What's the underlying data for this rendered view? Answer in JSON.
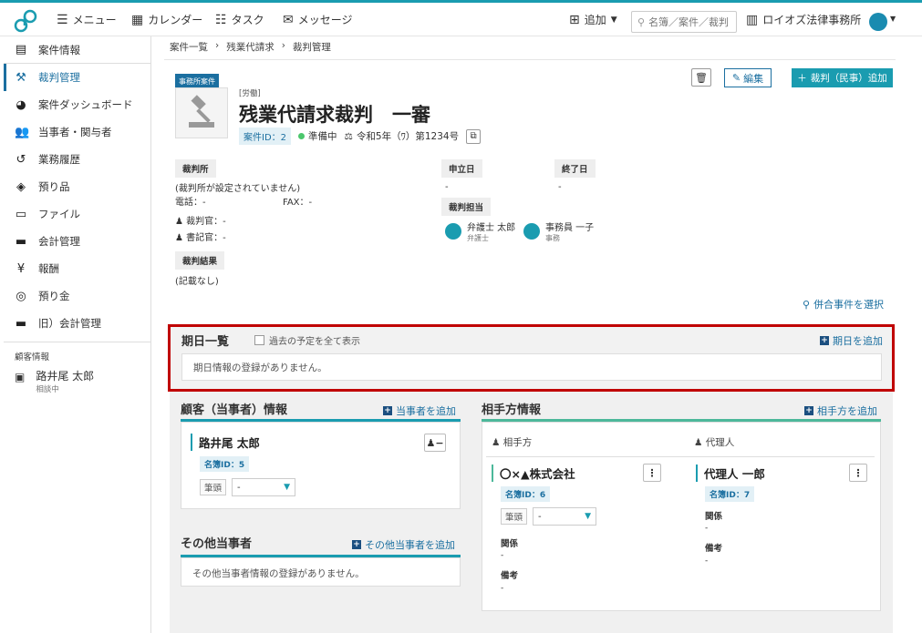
{
  "header": {
    "menu": "メニュー",
    "calendar": "カレンダー",
    "task": "タスク",
    "message": "メッセージ",
    "add": "追加",
    "search_placeholder": "名簿／案件／裁判",
    "office": "ロイオズ法律事務所"
  },
  "sidebar": {
    "items": [
      {
        "label": "案件情報",
        "icon": "document-icon"
      },
      {
        "label": "裁判管理",
        "icon": "gavel-icon"
      },
      {
        "label": "案件ダッシュボード",
        "icon": "dashboard-icon"
      },
      {
        "label": "当事者・関与者",
        "icon": "users-icon"
      },
      {
        "label": "業務履歴",
        "icon": "history-icon"
      },
      {
        "label": "預り品",
        "icon": "box-icon"
      },
      {
        "label": "ファイル",
        "icon": "folder-icon"
      },
      {
        "label": "会計管理",
        "icon": "card-icon"
      },
      {
        "label": "報酬",
        "icon": "yen-icon"
      },
      {
        "label": "預り金",
        "icon": "coins-icon"
      },
      {
        "label": "旧）会計管理",
        "icon": "card-icon"
      }
    ],
    "section": "顧客情報",
    "client": {
      "name": "路井尾 太郎",
      "status": "相談中"
    }
  },
  "breadcrumb": [
    "案件一覧",
    "残業代請求",
    "裁判管理"
  ],
  "case": {
    "badge": "事務所案件",
    "type": "[労働]",
    "title": "残業代請求裁判　一審",
    "id": "案件ID：2",
    "status": "準備中",
    "docket": "令和5年（ﾜ）第1234号"
  },
  "buttons": {
    "edit": "編集",
    "add_trial": "裁判（民事）追加"
  },
  "court": {
    "label": "裁判所",
    "name": "(裁判所が設定されていません)",
    "phone": "電話：-",
    "fax": "FAX：-",
    "judge": "裁判官：-",
    "clerk": "書記官：-"
  },
  "dates": {
    "filed_label": "申立日",
    "filed": "-",
    "end_label": "終了日",
    "end": "-"
  },
  "staff": {
    "label": "裁判担当",
    "members": [
      {
        "name": "弁護士 太郎",
        "role": "弁護士"
      },
      {
        "name": "事務員 一子",
        "role": "事務"
      }
    ]
  },
  "result": {
    "label": "裁判結果",
    "value": "(記載なし)"
  },
  "joint_link": "併合事件を選択",
  "schedule": {
    "title": "期日一覧",
    "past_toggle": "過去の予定を全て表示",
    "add": "期日を追加",
    "empty": "期日情報の登録がありません。"
  },
  "client_section": {
    "title": "顧客（当事者）情報",
    "add": "当事者を追加",
    "name": "路井尾 太郎",
    "roster_id": "名簿ID：5",
    "tag": "筆頭",
    "select": "-"
  },
  "other_section": {
    "title": "その他当事者",
    "add": "その他当事者を追加",
    "empty": "その他当事者情報の登録がありません。"
  },
  "opponent_section": {
    "title": "相手方情報",
    "add": "相手方を追加",
    "col_opponent": "相手方",
    "col_agent": "代理人",
    "opponent": {
      "name": "〇×▲株式会社",
      "roster_id": "名簿ID：6",
      "tag": "筆頭",
      "select": "-",
      "relation_label": "関係",
      "relation": "-",
      "note_label": "備考",
      "note": "-"
    },
    "agent": {
      "name": "代理人 一郎",
      "roster_id": "名簿ID：7",
      "relation_label": "関係",
      "relation": "-",
      "note_label": "備考",
      "note": "-"
    }
  },
  "colors": {
    "accent": "#1a9cb0",
    "primary": "#1b6fa0",
    "highlight": "#c00000"
  }
}
